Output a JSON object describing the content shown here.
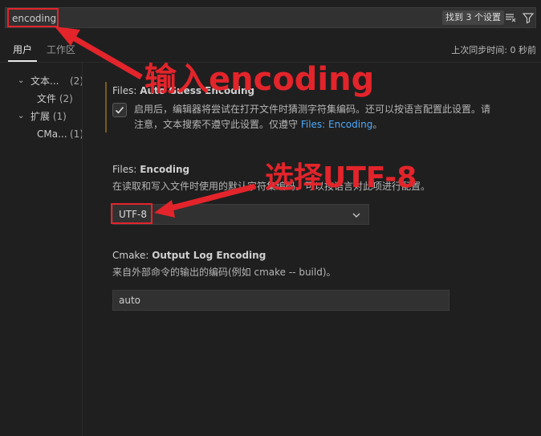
{
  "search": {
    "value": "encoding",
    "result_badge": "找到 3 个设置"
  },
  "tabs": [
    {
      "label": "用户"
    },
    {
      "label": "工作区"
    }
  ],
  "sync_status": "上次同步时间: 0 秒前",
  "tree": [
    {
      "label": "文本...",
      "count": "(2)"
    },
    {
      "label": "文件",
      "count": "(2)"
    },
    {
      "label": "扩展",
      "count": "(1)"
    },
    {
      "label": "CMa...",
      "count": "(1)"
    }
  ],
  "settings": {
    "auto_guess": {
      "category": "Files: ",
      "name": "Auto Guess Encoding",
      "desc_line1": "启用后，编辑器将尝试在打开文件时猜测字符集编码。还可以按语言配置此设置。请",
      "desc_line2_prefix": "注意，文本搜索不遵守此设置。仅遵守 ",
      "desc_link": "Files: Encoding",
      "desc_line2_suffix": "。"
    },
    "encoding": {
      "category": "Files: ",
      "name": "Encoding",
      "desc": "在读取和写入文件时使用的默认字符集编码。可以按语言对此项进行配置。",
      "value": "UTF-8"
    },
    "cmake": {
      "category": "Cmake: ",
      "name": "Output Log Encoding",
      "desc": "来自外部命令的输出的编码(例如 cmake -- build)。",
      "value": "auto"
    }
  },
  "annotations": {
    "input": "输入encoding",
    "select": "选择UTF-8"
  },
  "colors": {
    "accent_red": "#e3242b",
    "link": "#4daafc",
    "background": "#1f1f1f"
  }
}
